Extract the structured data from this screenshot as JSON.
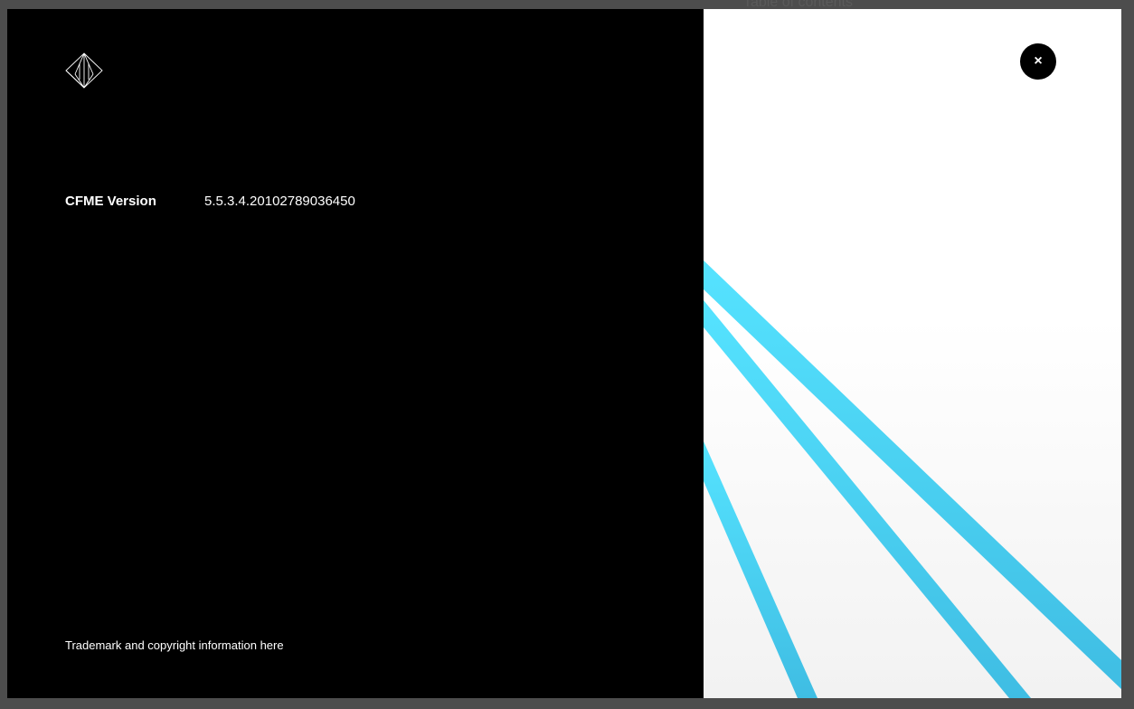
{
  "background": {
    "toc_label": "Table of contents"
  },
  "about": {
    "version_label": "CFME Version",
    "version_value": "5.5.3.4.20102789036450",
    "trademark_prefix": "Trademark and copyright information ",
    "trademark_link": "here"
  },
  "close": {
    "icon": "close-icon",
    "glyph": "×"
  },
  "colors": {
    "modal_bg": "#000000",
    "accent_line": "#47c9ec",
    "right_pane_bg": "#ffffff",
    "backdrop": "#4d4d4d"
  }
}
